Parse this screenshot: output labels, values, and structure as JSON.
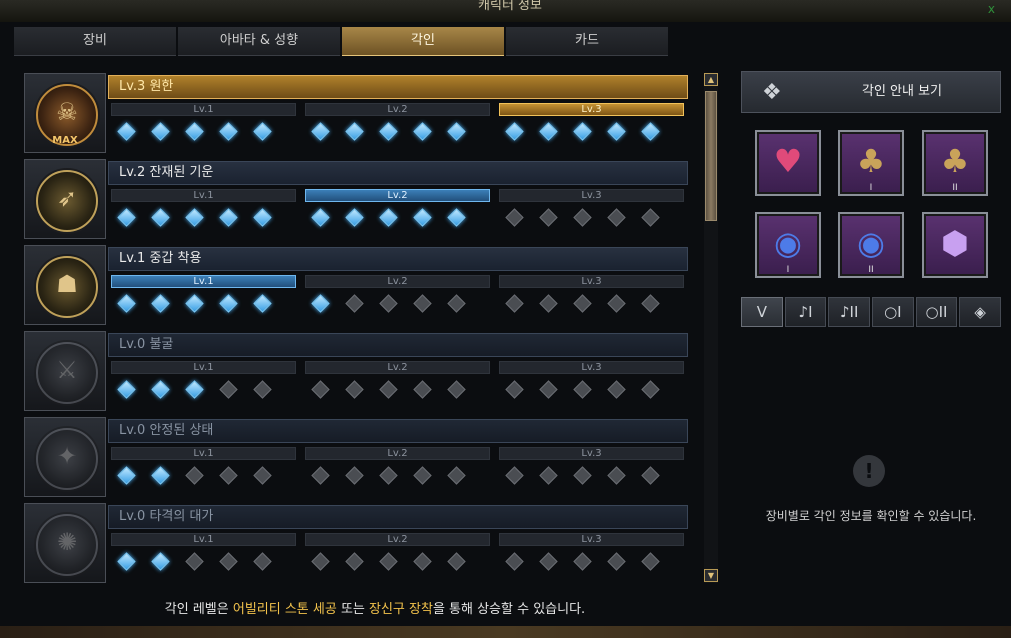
{
  "window": {
    "title": "캐릭터 정보"
  },
  "tabs": [
    {
      "label": "장비",
      "active": false
    },
    {
      "label": "아바타 & 성향",
      "active": false
    },
    {
      "label": "각인",
      "active": true
    },
    {
      "label": "카드",
      "active": false
    }
  ],
  "level_labels": [
    "Lv.1",
    "Lv.2",
    "Lv.3"
  ],
  "engravings": [
    {
      "name": "Lv.3 원한",
      "level": 3,
      "gems_filled": 15,
      "badge": "MAX",
      "icon": "demon-portrait-icon"
    },
    {
      "name": "Lv.2 잔재된 기운",
      "level": 2,
      "gems_filled": 10,
      "badge": "",
      "icon": "archer-portrait-icon"
    },
    {
      "name": "Lv.1 중갑 착용",
      "level": 1,
      "gems_filled": 6,
      "badge": "",
      "icon": "armor-portrait-icon"
    },
    {
      "name": "Lv.0 불굴",
      "level": 0,
      "gems_filled": 3,
      "badge": "",
      "icon": "warrior-portrait-icon"
    },
    {
      "name": "Lv.0 안정된 상태",
      "level": 0,
      "gems_filled": 2,
      "badge": "",
      "icon": "mage-portrait-icon"
    },
    {
      "name": "Lv.0 타격의 대가",
      "level": 0,
      "gems_filled": 2,
      "badge": "",
      "icon": "burst-portrait-icon"
    }
  ],
  "footer": {
    "prefix": "각인 레벨은 ",
    "highlight1": "어빌리티 스톤 세공",
    "middle": " 또는 ",
    "highlight2": "장신구 장착",
    "suffix": "을 통해 상승할 수 있습니다."
  },
  "side": {
    "guide_button": "각인 안내 보기",
    "slots": [
      {
        "icon": "necklace-icon",
        "sub": ""
      },
      {
        "icon": "earring-icon",
        "sub": "I"
      },
      {
        "icon": "earring-icon",
        "sub": "II"
      },
      {
        "icon": "ring-icon",
        "sub": "I"
      },
      {
        "icon": "ring-icon",
        "sub": "II"
      },
      {
        "icon": "ability-stone-icon",
        "sub": ""
      }
    ],
    "filters": [
      {
        "icon": "necklace-filter-icon",
        "label": "ⴸ"
      },
      {
        "icon": "earring-filter-icon",
        "label": "♪I"
      },
      {
        "icon": "earring-filter-icon",
        "label": "♪II"
      },
      {
        "icon": "ring-filter-icon",
        "label": "○I"
      },
      {
        "icon": "ring-filter-icon",
        "label": "○II"
      },
      {
        "icon": "stone-filter-icon",
        "label": "◈"
      }
    ],
    "info_text": "장비별로 각인 정보를 확인할 수 있습니다."
  },
  "colors": {
    "gold": "#f3c34c",
    "blue": "#3aa0e6",
    "purple": "#5a3270"
  }
}
